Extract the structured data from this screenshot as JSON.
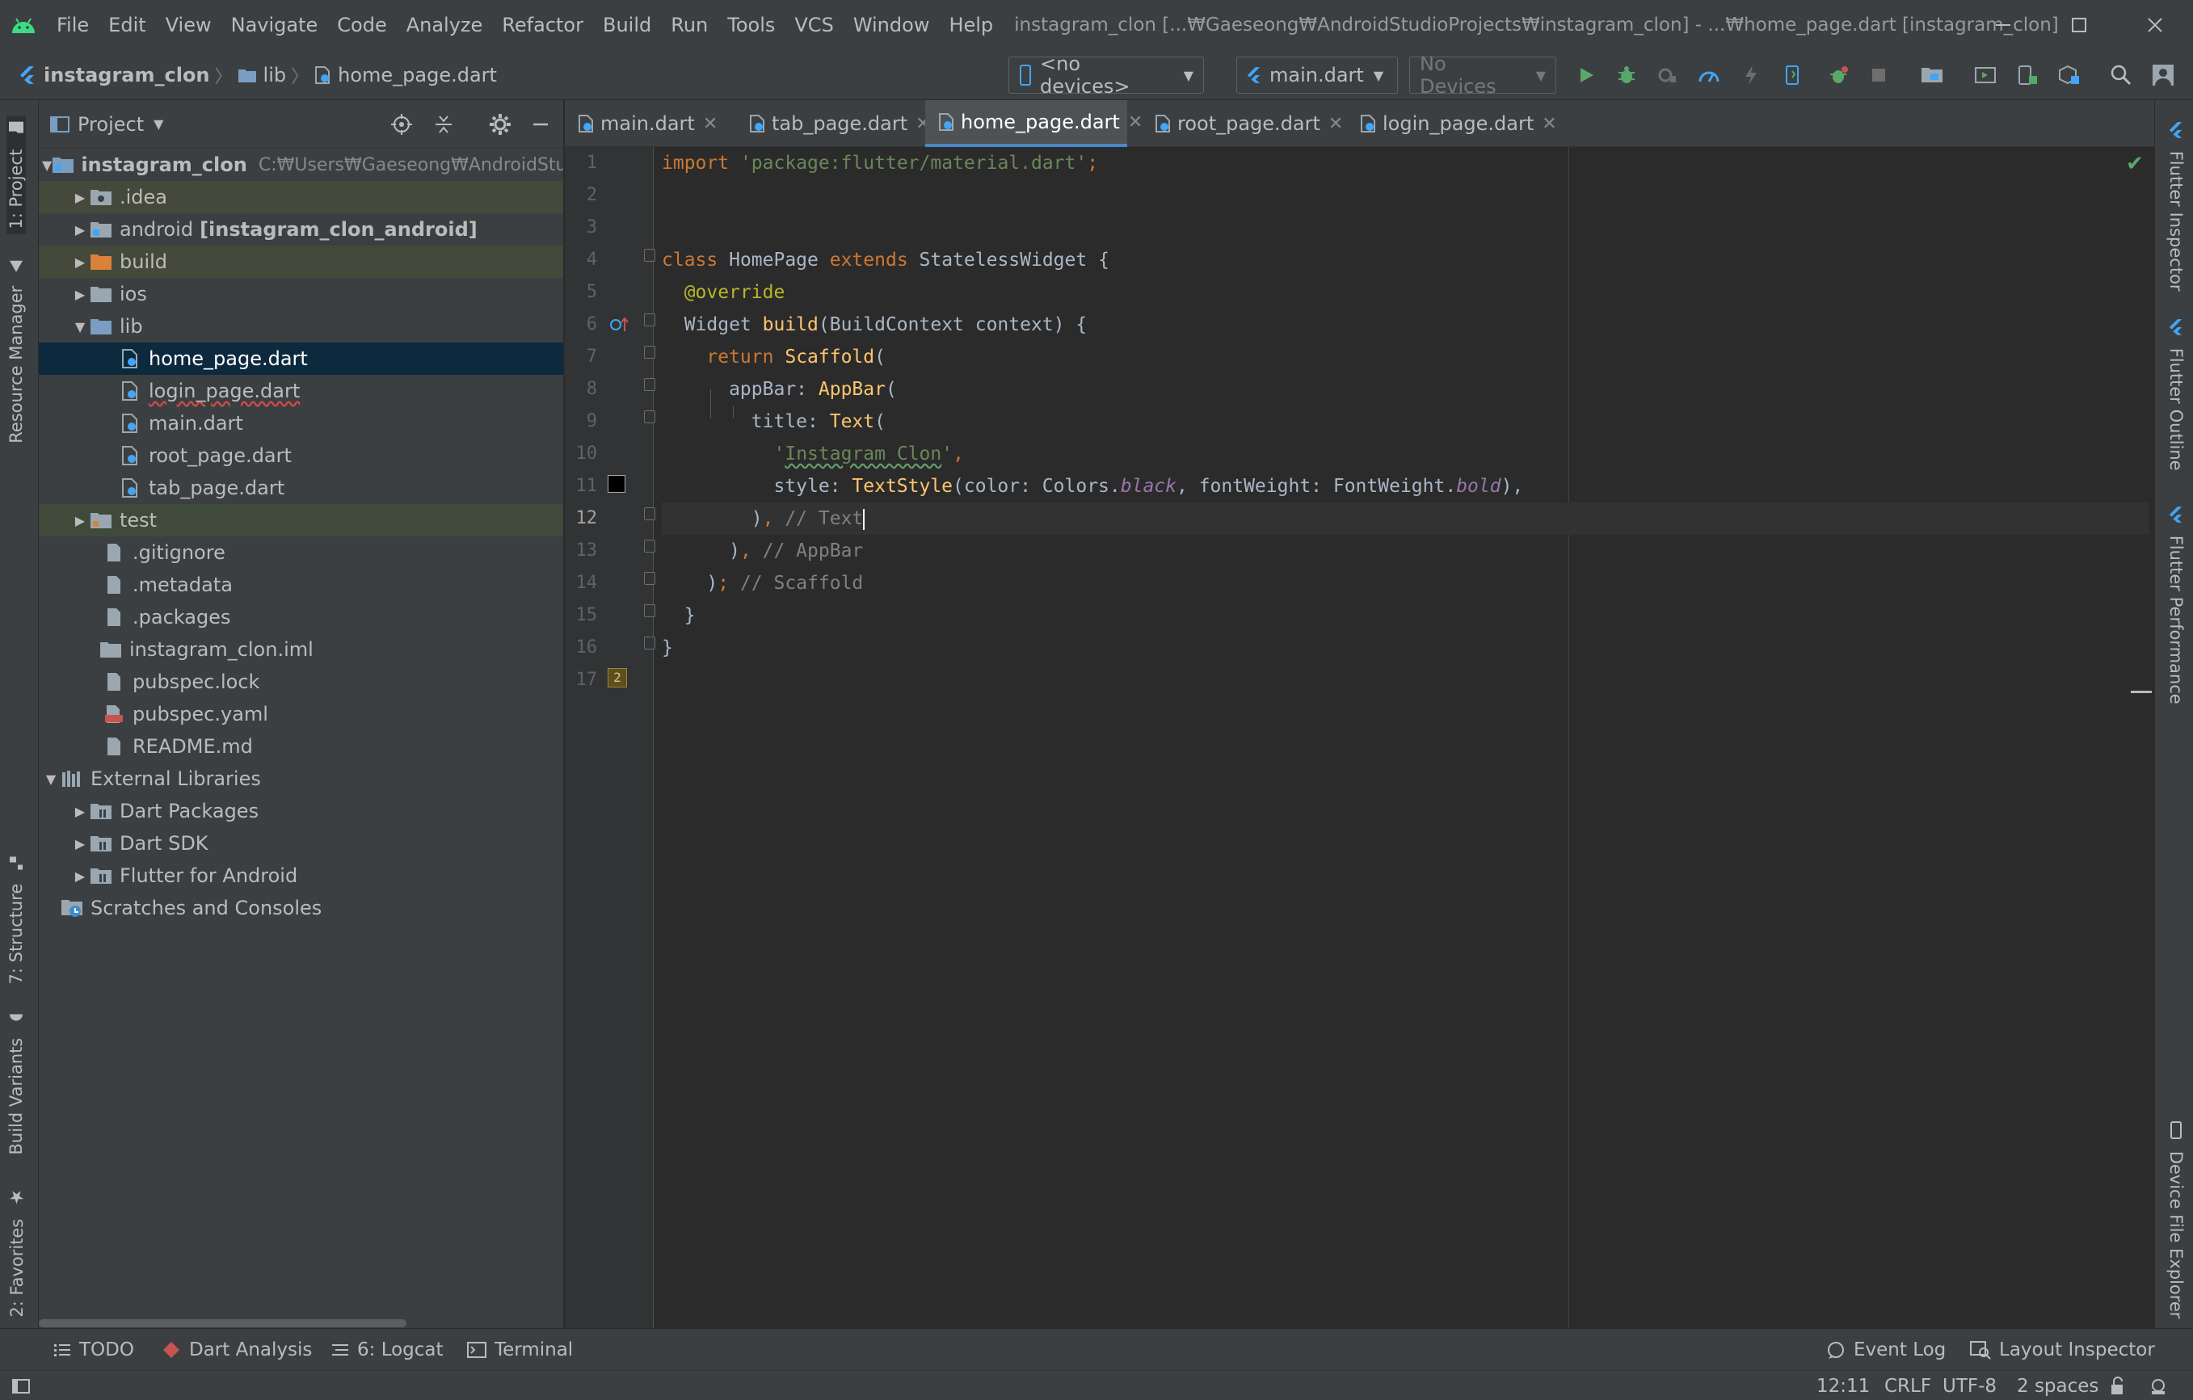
{
  "app": {
    "logo_icon": "android-studio-logo-icon",
    "menu": [
      "File",
      "Edit",
      "View",
      "Navigate",
      "Code",
      "Analyze",
      "Refactor",
      "Build",
      "Run",
      "Tools",
      "VCS",
      "Window",
      "Help"
    ],
    "window_title": "instagram_clon [...₩Gaeseong₩AndroidStudioProjects₩instagram_clon] - ...₩home_page.dart [instagram_clon]"
  },
  "navbar": {
    "breadcrumb": [
      "instagram_clon",
      "lib",
      "home_page.dart"
    ],
    "device_combo": "<no devices>",
    "run_config": "main.dart",
    "devices_combo": "No Devices"
  },
  "left_tool_tabs": [
    "1: Project",
    "Resource Manager",
    "7: Structure",
    "Build Variants",
    "2: Favorites"
  ],
  "right_tool_tabs": [
    "Flutter Inspector",
    "Flutter Outline",
    "Flutter Performance",
    "Device File Explorer"
  ],
  "project": {
    "title": "Project",
    "tree": [
      {
        "label": "instagram_clon",
        "path": "C:₩Users₩Gaeseong₩AndroidStudioProjects₩instagram_clon"
      },
      {
        "label": ".idea"
      },
      {
        "label": "android",
        "suffix": "[instagram_clon_android]"
      },
      {
        "label": "build"
      },
      {
        "label": "ios"
      },
      {
        "label": "lib"
      },
      {
        "label": "home_page.dart"
      },
      {
        "label": "login_page.dart"
      },
      {
        "label": "main.dart"
      },
      {
        "label": "root_page.dart"
      },
      {
        "label": "tab_page.dart"
      },
      {
        "label": "test"
      },
      {
        "label": ".gitignore"
      },
      {
        "label": ".metadata"
      },
      {
        "label": ".packages"
      },
      {
        "label": "instagram_clon.iml"
      },
      {
        "label": "pubspec.lock"
      },
      {
        "label": "pubspec.yaml"
      },
      {
        "label": "README.md"
      },
      {
        "label": "External Libraries"
      },
      {
        "label": "Dart Packages"
      },
      {
        "label": "Dart SDK"
      },
      {
        "label": "Flutter for Android"
      },
      {
        "label": "Scratches and Consoles"
      }
    ]
  },
  "editor": {
    "tabs": [
      "main.dart",
      "tab_page.dart",
      "home_page.dart",
      "root_page.dart",
      "login_page.dart"
    ],
    "active_tab": "home_page.dart",
    "line_numbers": [
      "1",
      "2",
      "3",
      "4",
      "5",
      "6",
      "7",
      "8",
      "9",
      "10",
      "11",
      "12",
      "13",
      "14",
      "15",
      "16",
      "17"
    ],
    "current_line": "12",
    "hint_badge": "2",
    "code": {
      "l1": [
        "import",
        " ",
        "'package:flutter/material.dart'",
        ";"
      ],
      "l4": [
        "class",
        " HomePage ",
        "extends",
        " StatelessWidget {"
      ],
      "l5": [
        "  ",
        "@override"
      ],
      "l6": [
        "  Widget ",
        "build",
        "(BuildContext context) {"
      ],
      "l7": [
        "    ",
        "return",
        " ",
        "Scaffold",
        "("
      ],
      "l8": [
        "      appBar: ",
        "AppBar",
        "("
      ],
      "l9": [
        "        title: ",
        "Text",
        "("
      ],
      "l10": [
        "          ",
        "'",
        "Instagram Clon",
        "'",
        ","
      ],
      "l11": [
        "          style: ",
        "TextStyle",
        "(color: Colors.",
        "black",
        ", fontWeight: FontWeight.",
        "bold",
        "),"
      ],
      "l12": [
        "        )",
        ",",
        " // Text"
      ],
      "l13": [
        "      )",
        ",",
        " // AppBar"
      ],
      "l14": [
        "    )",
        ";",
        " // Scaffold"
      ],
      "l15": [
        "  }"
      ],
      "l16": [
        "}"
      ]
    }
  },
  "bottom_tools": [
    "TODO",
    "Dart Analysis",
    "6: Logcat",
    "Terminal",
    "Event Log",
    "Layout Inspector"
  ],
  "status": {
    "position": "12:11",
    "line_sep": "CRLF",
    "encoding": "UTF-8",
    "indent": "2 spaces"
  }
}
